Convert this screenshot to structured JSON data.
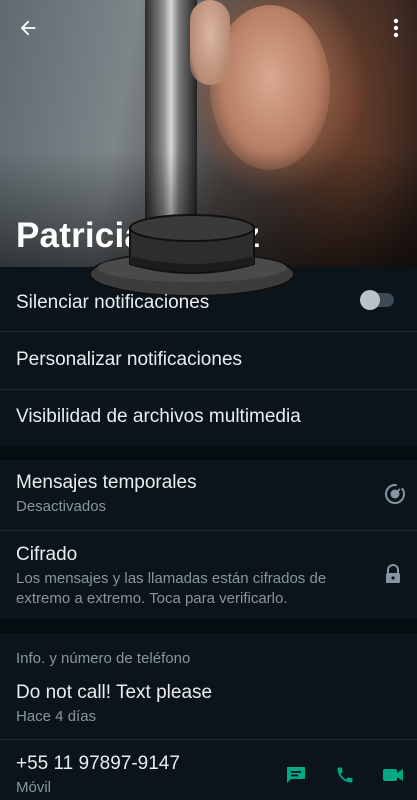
{
  "contact": {
    "name": "Patricia Ferraz"
  },
  "settings": {
    "mute_label": "Silenciar notificaciones",
    "custom_notifications_label": "Personalizar notificaciones",
    "media_visibility_label": "Visibilidad de archivos multimedia"
  },
  "privacy": {
    "temp_messages_label": "Mensajes temporales",
    "temp_messages_status": "Desactivados",
    "encryption_label": "Cifrado",
    "encryption_desc": "Los mensajes y las llamadas están cifrados de extremo a extremo. Toca para verificarlo."
  },
  "info": {
    "section_label": "Info. y número de teléfono",
    "about": "Do not call! Text please",
    "about_date": "Hace 4 días",
    "phone": "+55 11 97897-9147",
    "phone_type": "Móvil"
  },
  "colors": {
    "accent": "#00a884",
    "background": "#0b141a",
    "muted": "#8696a0"
  },
  "icons": [
    "back-arrow-icon",
    "more-vert-icon",
    "timer-icon",
    "lock-icon",
    "message-icon",
    "phone-icon",
    "video-icon"
  ]
}
